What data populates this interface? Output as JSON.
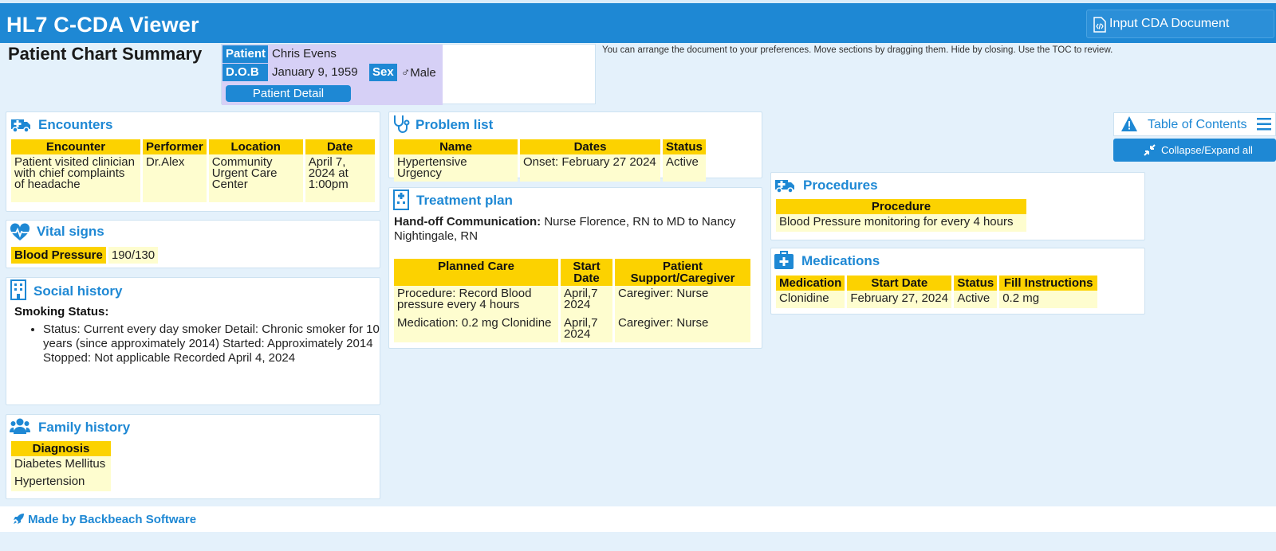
{
  "app": {
    "title": "HL7 C-CDA Viewer",
    "input_button": "Input CDA Document"
  },
  "page": {
    "title": "Patient Chart Summary",
    "hint": "You can arrange the document to your preferences. Move sections by dragging them. Hide by closing. Use the TOC to review."
  },
  "patient": {
    "patient_label": "Patient",
    "name": "Chris Evens",
    "dob_label": "D.O.B",
    "dob": "January 9, 1959",
    "sex_label": "Sex",
    "sex": "♂Male",
    "detail_button": "Patient Detail"
  },
  "encounters": {
    "title": "Encounters",
    "headers": [
      "Encounter",
      "Performer",
      "Location",
      "Date"
    ],
    "rows": [
      [
        "Patient visited clinician with chief complaints of headache",
        "Dr.Alex",
        "Community Urgent Care Center",
        "April 7, 2024 at 1:00pm"
      ]
    ]
  },
  "vitals": {
    "title": "Vital signs",
    "label": "Blood Pressure",
    "value": "190/130"
  },
  "social": {
    "title": "Social history",
    "subtitle": "Smoking Status:",
    "item": "Status: Current every day smoker Detail: Chronic smoker for 10 years (since approximately 2014) Started: Approximately 2014 Stopped: Not applicable Recorded April 4, 2024"
  },
  "family": {
    "title": "Family history",
    "header": "Diagnosis",
    "rows": [
      "Diabetes Mellitus",
      "Hypertension"
    ]
  },
  "problems": {
    "title": "Problem list",
    "headers": [
      "Name",
      "Dates",
      "Status"
    ],
    "rows": [
      [
        "Hypertensive Urgency",
        "Onset: February 27 2024",
        "Active"
      ]
    ]
  },
  "treatment": {
    "title": "Treatment plan",
    "handoff_label": "Hand-off Communication:",
    "handoff_text": " Nurse Florence, RN to MD to Nancy Nightingale, RN",
    "headers": [
      "Planned Care",
      "Start Date",
      "Patient Support/Caregiver"
    ],
    "rows": [
      [
        "Procedure: Record Blood pressure every 4 hours",
        "April,7 2024",
        "Caregiver: Nurse"
      ],
      [
        "Medication: 0.2 mg Clonidine",
        "April,7 2024",
        "Caregiver: Nurse"
      ]
    ]
  },
  "procedures": {
    "title": "Procedures",
    "header": "Procedure",
    "rows": [
      "Blood Pressure monitoring for every 4 hours"
    ]
  },
  "medications": {
    "title": "Medications",
    "headers": [
      "Medication",
      "Start Date",
      "Status",
      "Fill Instructions"
    ],
    "rows": [
      [
        "Clonidine",
        "February 27, 2024",
        "Active",
        "0.2 mg"
      ]
    ]
  },
  "toc": {
    "label": "Table of Contents",
    "collapse_label": "Collapse/Expand all"
  },
  "footer": {
    "label": "Made by Backbeach Software"
  },
  "colors": {
    "brand": "#1e88d4",
    "header_fill": "#fcd200",
    "cell_fill": "#fefdcf",
    "patient_panel": "#d6d0f6"
  }
}
